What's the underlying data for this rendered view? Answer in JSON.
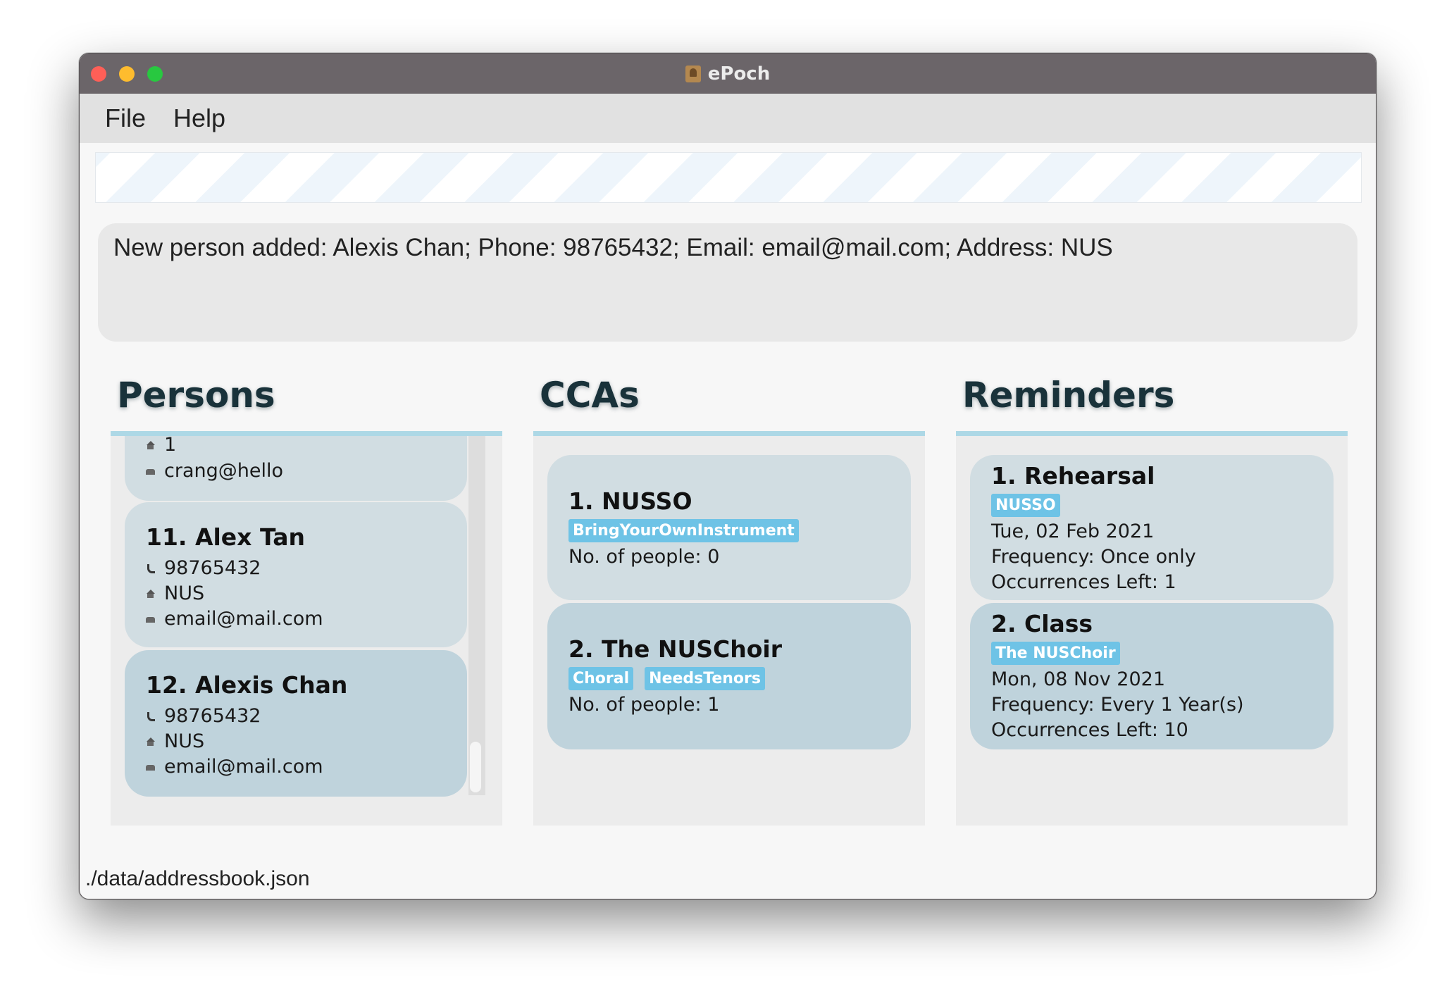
{
  "window": {
    "title": "ePoch"
  },
  "menu": {
    "file": "File",
    "help": "Help"
  },
  "command_box": {
    "value": ""
  },
  "result": {
    "text": "New person added: Alexis Chan; Phone: 98765432; Email: email@mail.com; Address: NUS"
  },
  "persons": {
    "title": "Persons",
    "partial_card": {
      "address": "1",
      "email": "crang@hello"
    },
    "cards": [
      {
        "name": "11.  Alex Tan",
        "phone": "98765432",
        "address": "NUS",
        "email": "email@mail.com"
      },
      {
        "name": "12.  Alexis Chan",
        "phone": "98765432",
        "address": "NUS",
        "email": "email@mail.com"
      }
    ]
  },
  "ccas": {
    "title": "CCAs",
    "cards": [
      {
        "name": "1.  NUSSO",
        "tags": [
          "BringYourOwnInstrument"
        ],
        "people": "No. of people: 0"
      },
      {
        "name": "2.  The NUSChoir",
        "tags": [
          "Choral",
          "NeedsTenors"
        ],
        "people": "No. of people: 1"
      }
    ]
  },
  "reminders": {
    "title": "Reminders",
    "cards": [
      {
        "name": "1.  Rehearsal",
        "tag": "NUSSO",
        "date": "Tue, 02 Feb 2021",
        "frequency": "Frequency: Once only",
        "occurrences": "Occurrences Left: 1"
      },
      {
        "name": "2.  Class",
        "tag": "The NUSChoir",
        "date": "Mon, 08 Nov 2021",
        "frequency": "Frequency: Every 1 Year(s)",
        "occurrences": "Occurrences Left: 10"
      }
    ]
  },
  "status": {
    "path": "./data/addressbook.json"
  },
  "colors": {
    "accent": "#add8e6",
    "tag": "#6ec3e6",
    "card": "#d1dde2",
    "card_alt": "#bfd3dc"
  },
  "icons": [
    "phone-icon",
    "home-icon",
    "mail-icon"
  ]
}
